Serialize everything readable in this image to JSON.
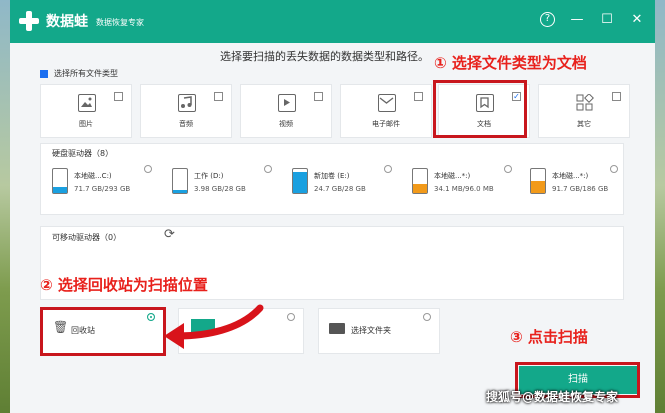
{
  "app": {
    "name": "数据蛙",
    "subtitle": "数据恢复专家"
  },
  "titlebar_icons": [
    "help-icon",
    "minimize-icon",
    "maximize-icon",
    "close-icon"
  ],
  "instruction": "选择要扫描的丢失数据的数据类型和路径。",
  "annotations": {
    "step1": "① 选择文件类型为文档",
    "step2": "② 选择回收站为扫描位置",
    "step3": "③ 点击扫描"
  },
  "select_all": {
    "label": "选择所有文件类型",
    "checked": true
  },
  "file_types": [
    {
      "label": "图片",
      "icon": "image-icon",
      "checked": false
    },
    {
      "label": "音频",
      "icon": "audio-icon",
      "checked": false
    },
    {
      "label": "视频",
      "icon": "video-icon",
      "checked": false
    },
    {
      "label": "电子邮件",
      "icon": "email-icon",
      "checked": false
    },
    {
      "label": "文档",
      "icon": "document-icon",
      "checked": true
    },
    {
      "label": "其它",
      "icon": "other-icon",
      "checked": false
    }
  ],
  "hard_drives": {
    "title": "硬盘驱动器（8）",
    "items": [
      {
        "name": "本地磁...C:)",
        "size": "71.7 GB/293 GB",
        "used": 0.24,
        "color": "#1aa0e0"
      },
      {
        "name": "工作 (D:)",
        "size": "3.98 GB/28 GB",
        "used": 0.14,
        "color": "#1aa0e0"
      },
      {
        "name": "新加卷 (E:)",
        "size": "24.7 GB/28 GB",
        "used": 0.88,
        "color": "#1aa0e0"
      },
      {
        "name": "本地磁...*:)",
        "size": "34.1 MB/96.0 MB",
        "used": 0.36,
        "color": "#f29a1a"
      },
      {
        "name": "本地磁...*:)",
        "size": "91.7 GB/186 GB",
        "used": 0.49,
        "color": "#f29a1a"
      }
    ]
  },
  "removable": {
    "title": "可移动驱动器（0）",
    "refresh_icon": "refresh-icon"
  },
  "locations": [
    {
      "label": "回收站",
      "icon": "recycle-bin-icon",
      "selected": true
    },
    {
      "label": "",
      "icon": "desktop-icon",
      "selected": false
    },
    {
      "label": "选择文件夹",
      "icon": "folder-icon",
      "selected": false
    }
  ],
  "scan_button": "扫描",
  "watermark": "搜狐号@数据蛙恢复专家",
  "colors": {
    "brand": "#13a88a",
    "annotation_red": "#c8161d"
  }
}
